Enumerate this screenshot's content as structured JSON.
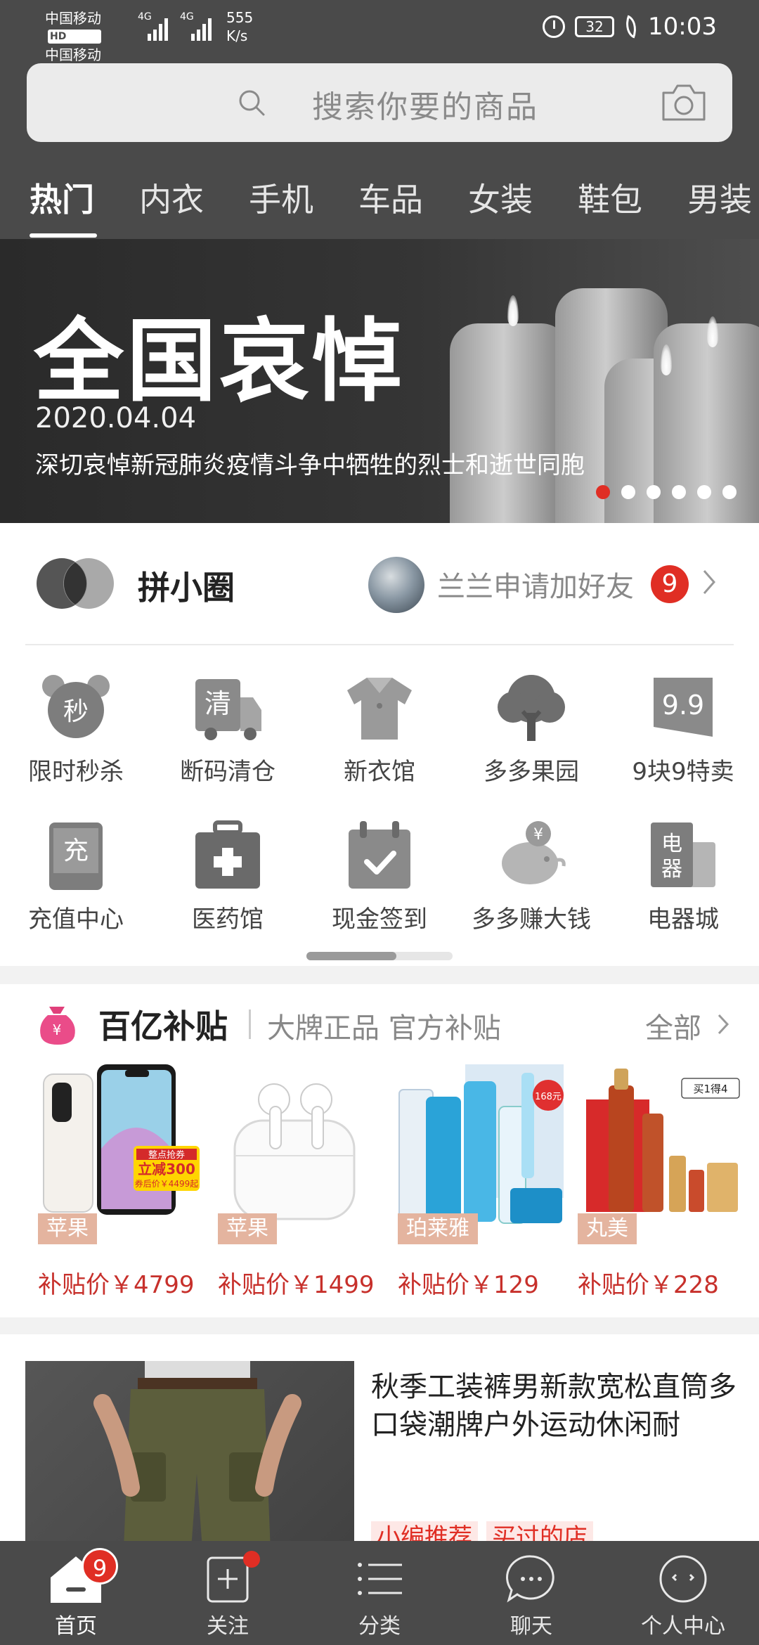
{
  "status_bar": {
    "carrier_1": "中国移动",
    "carrier_2": "中国移动",
    "hd_badge": "HD",
    "signal_label": "4G",
    "net_speed_value": "555",
    "net_speed_unit": "K/s",
    "battery": "32",
    "time": "10:03"
  },
  "search": {
    "placeholder": "搜索你要的商品",
    "icon": "search-icon",
    "camera_icon": "camera-icon"
  },
  "tabs": [
    {
      "label": "热门",
      "active": true
    },
    {
      "label": "内衣",
      "active": false
    },
    {
      "label": "手机",
      "active": false
    },
    {
      "label": "车品",
      "active": false
    },
    {
      "label": "女装",
      "active": false
    },
    {
      "label": "鞋包",
      "active": false
    },
    {
      "label": "男装",
      "active": false
    }
  ],
  "banner": {
    "title": "全国哀悼",
    "date": "2020.04.04",
    "subtitle": "深切哀悼新冠肺炎疫情斗争中牺牲的烈士和逝世同胞",
    "dot_count": 6,
    "active_dot": 0
  },
  "circle": {
    "title": "拼小圈",
    "friend_request": "兰兰申请加好友",
    "badge_count": "9"
  },
  "grid": [
    {
      "label": "限时秒杀",
      "icon": "alarm-clock-icon",
      "glyph": "秒"
    },
    {
      "label": "断码清仓",
      "icon": "truck-icon",
      "glyph": "清"
    },
    {
      "label": "新衣馆",
      "icon": "shirt-icon",
      "glyph": ""
    },
    {
      "label": "多多果园",
      "icon": "tree-icon",
      "glyph": ""
    },
    {
      "label": "9块9特卖",
      "icon": "price-tag-icon",
      "glyph": "9.9"
    },
    {
      "label": "充值中心",
      "icon": "recharge-icon",
      "glyph": "充"
    },
    {
      "label": "医药馆",
      "icon": "medicine-box-icon",
      "glyph": ""
    },
    {
      "label": "现金签到",
      "icon": "calendar-check-icon",
      "glyph": ""
    },
    {
      "label": "多多赚大钱",
      "icon": "piggy-bank-icon",
      "glyph": "¥"
    },
    {
      "label": "电器城",
      "icon": "appliance-icon",
      "glyph": "电器"
    }
  ],
  "subsidy": {
    "title": "百亿补贴",
    "subtitle": "大牌正品 官方补贴",
    "all_label": "全部",
    "bag_glyph": "¥",
    "products": [
      {
        "brand": "苹果",
        "price": "补贴价￥4799",
        "promo_1": "整点抢券",
        "promo_2": "立减300",
        "promo_3": "券后价￥4499起"
      },
      {
        "brand": "苹果",
        "price": "补贴价￥1499"
      },
      {
        "brand": "珀莱雅",
        "price": "补贴价￥129",
        "promo_price": "168元"
      },
      {
        "brand": "丸美",
        "price": "补贴价￥228",
        "promo_tag": "买1得4"
      }
    ]
  },
  "feed": {
    "title": "秋季工装裤男新款宽松直筒多口袋潮牌户外运动休闲耐",
    "tags": [
      "小编推荐",
      "买过的店"
    ]
  },
  "bottom_nav": [
    {
      "label": "首页",
      "icon": "home-icon",
      "badge": "9",
      "active": true
    },
    {
      "label": "关注",
      "icon": "follow-icon",
      "dot": true,
      "active": false
    },
    {
      "label": "分类",
      "icon": "category-icon",
      "active": false
    },
    {
      "label": "聊天",
      "icon": "chat-icon",
      "active": false
    },
    {
      "label": "个人中心",
      "icon": "profile-icon",
      "active": false
    }
  ],
  "colors": {
    "header_bg": "#4a4a4a",
    "accent_red": "#e02e24",
    "price_red": "#c7302b",
    "brand_tag": "#e4b49f"
  }
}
